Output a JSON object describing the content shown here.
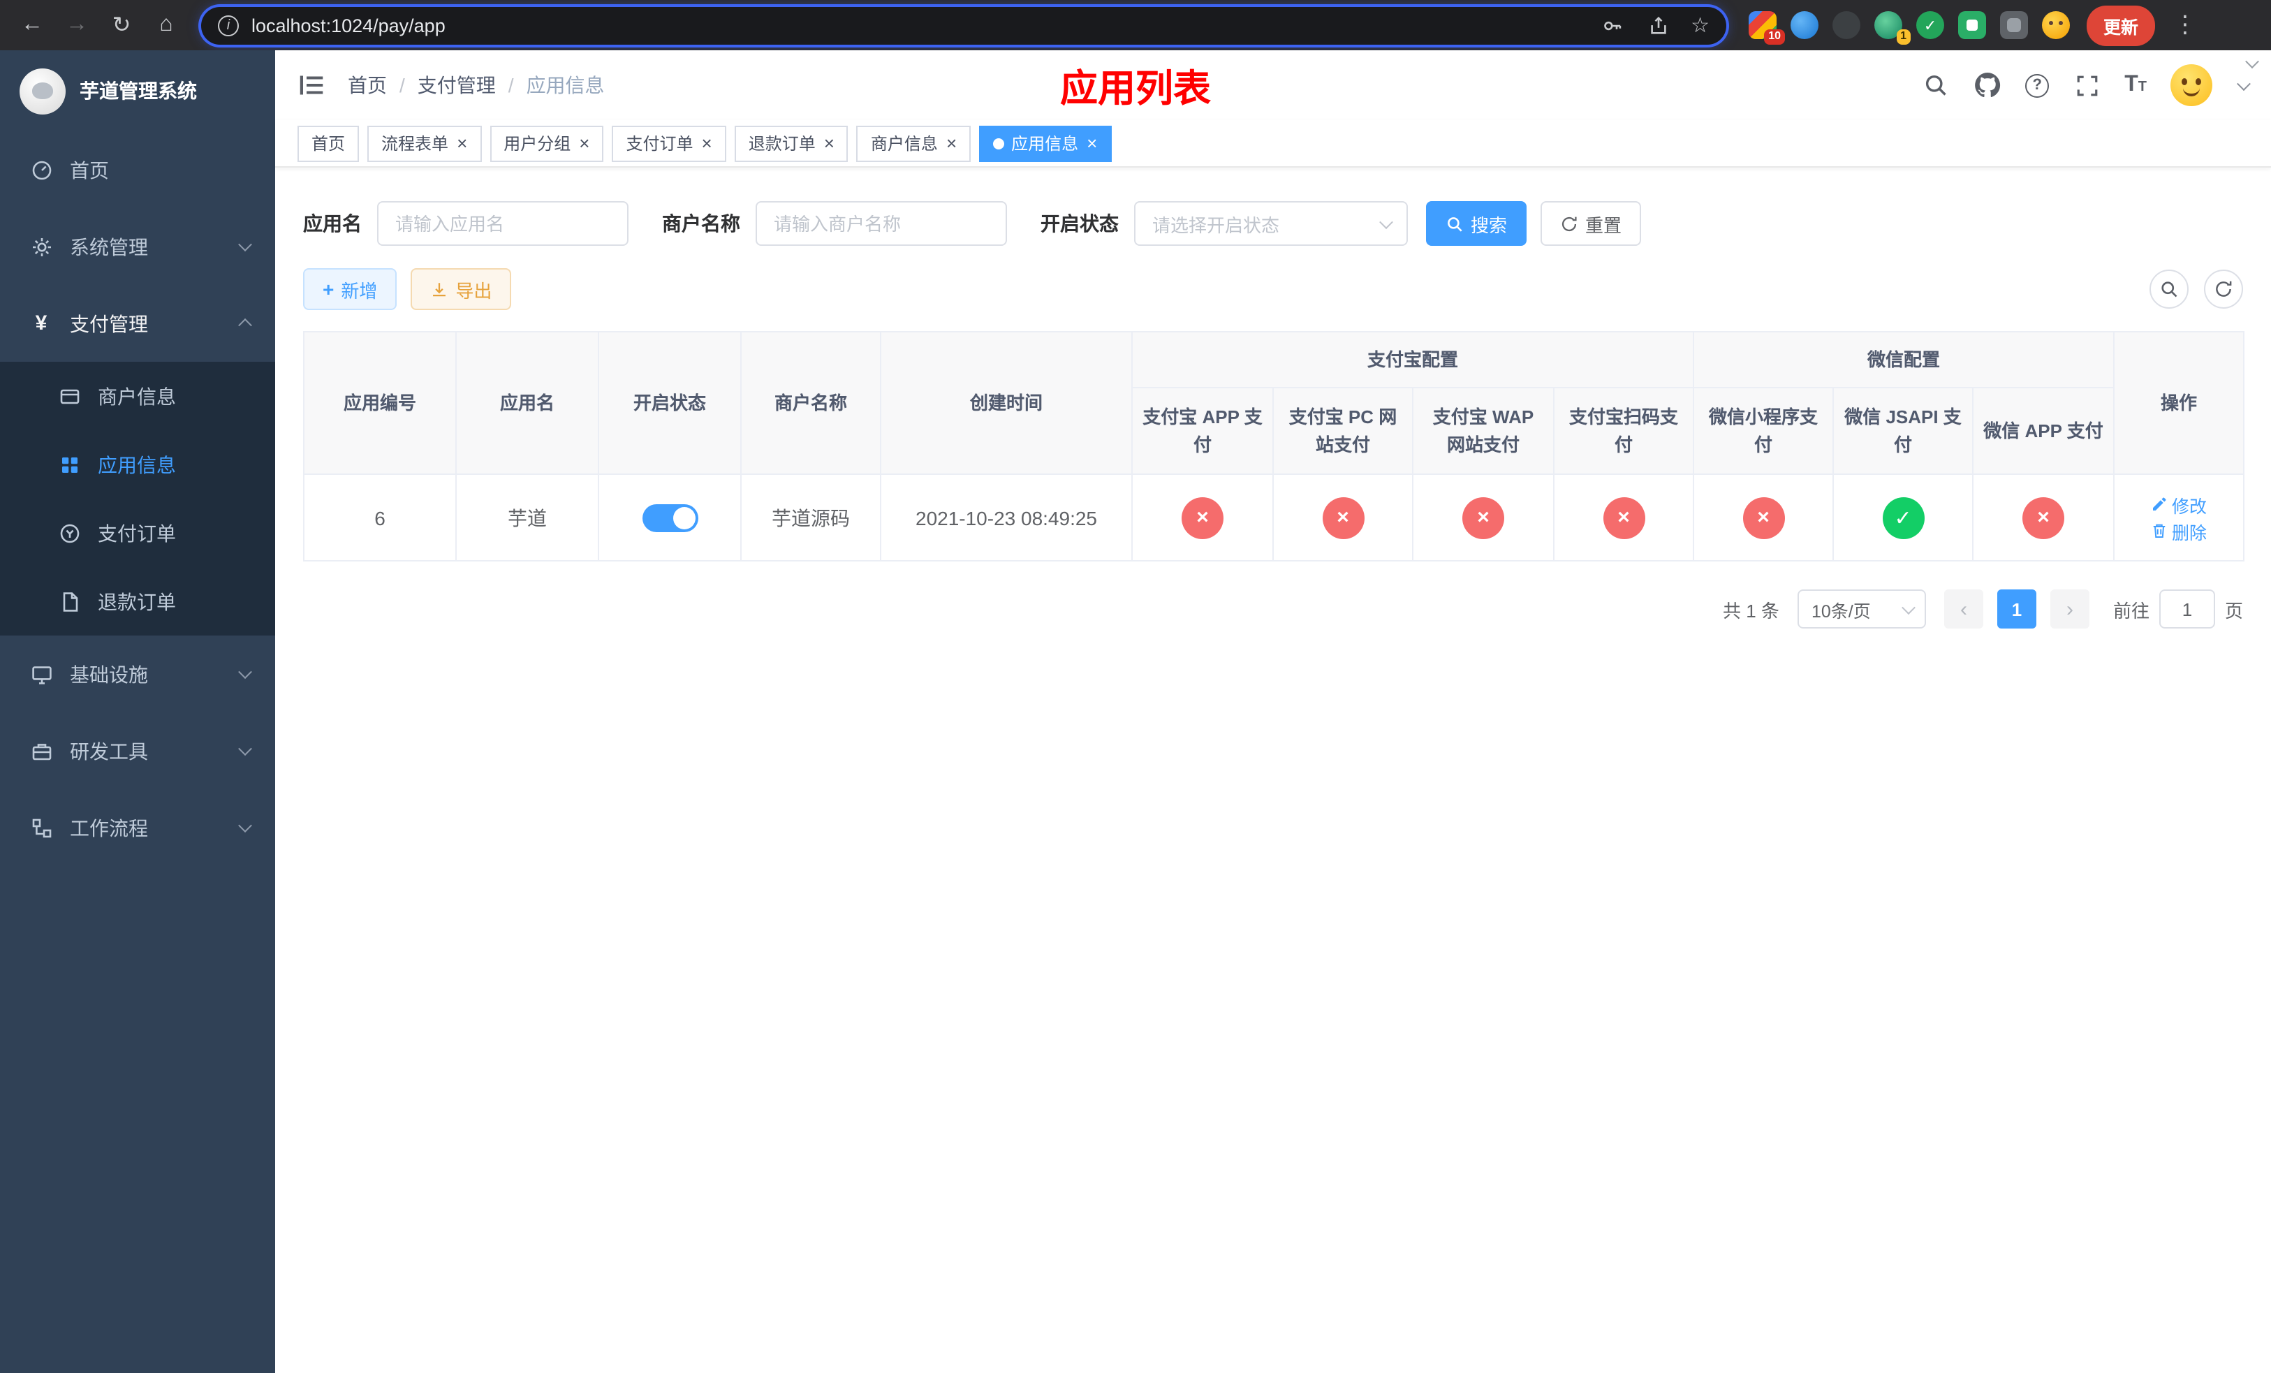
{
  "browser": {
    "url": "localhost:1024/pay/app",
    "update_label": "更新",
    "ext_badge_puzzle": "10",
    "ext_badge_avatar": "1"
  },
  "icons": {
    "back": "←",
    "forward": "→",
    "reload": "↻",
    "home": "⌂",
    "star": "☆",
    "menu": "⋮",
    "info": "i",
    "help": "?",
    "plus": "+",
    "prev": "‹",
    "next": "›",
    "big_t": "T",
    "small_t": "T"
  },
  "sidebar": {
    "logo_title": "芋道管理系统",
    "items": {
      "home": "首页",
      "system": "系统管理",
      "payment": "支付管理",
      "merchant": "商户信息",
      "app_info": "应用信息",
      "pay_order": "支付订单",
      "refund_order": "退款订单",
      "infrastructure": "基础设施",
      "dev_tools": "研发工具",
      "workflow": "工作流程"
    }
  },
  "header": {
    "breadcrumb": [
      "首页",
      "支付管理",
      "应用信息"
    ],
    "title": "应用列表"
  },
  "tabs": [
    {
      "label": "首页"
    },
    {
      "label": "流程表单"
    },
    {
      "label": "用户分组"
    },
    {
      "label": "支付订单"
    },
    {
      "label": "退款订单"
    },
    {
      "label": "商户信息"
    },
    {
      "label": "应用信息"
    }
  ],
  "filters": {
    "app_name_label": "应用名",
    "app_name_placeholder": "请输入应用名",
    "merchant_label": "商户名称",
    "merchant_placeholder": "请输入商户名称",
    "status_label": "开启状态",
    "status_placeholder": "请选择开启状态",
    "search_label": "搜索",
    "reset_label": "重置"
  },
  "toolbar": {
    "add_label": "新增",
    "export_label": "导出"
  },
  "table": {
    "group_alipay": "支付宝配置",
    "group_wechat": "微信配置",
    "col_id": "应用编号",
    "col_name": "应用名",
    "col_status": "开启状态",
    "col_merchant": "商户名称",
    "col_created": "创建时间",
    "col_alipay_app": "支付宝 APP 支付",
    "col_alipay_pc": "支付宝 PC 网站支付",
    "col_alipay_wap": "支付宝 WAP 网站支付",
    "col_alipay_scan": "支付宝扫码支付",
    "col_wx_mini": "微信小程序支付",
    "col_wx_jsapi": "微信 JSAPI 支付",
    "col_wx_app": "微信 APP 支付",
    "col_actions": "操作",
    "rows": [
      {
        "id": "6",
        "name": "芋道",
        "enabled": true,
        "merchant": "芋道源码",
        "created": "2021-10-23 08:49:25",
        "statuses": {
          "alipay_app": false,
          "alipay_pc": false,
          "alipay_wap": false,
          "alipay_scan": false,
          "wx_mini": false,
          "wx_jsapi": true,
          "wx_app": false
        },
        "edit_label": "修改",
        "delete_label": "删除"
      }
    ]
  },
  "pagination": {
    "total": "共 1 条",
    "page_size": "10条/页",
    "page": "1",
    "goto_label": "前往",
    "goto_value": "1",
    "unit": "页"
  }
}
